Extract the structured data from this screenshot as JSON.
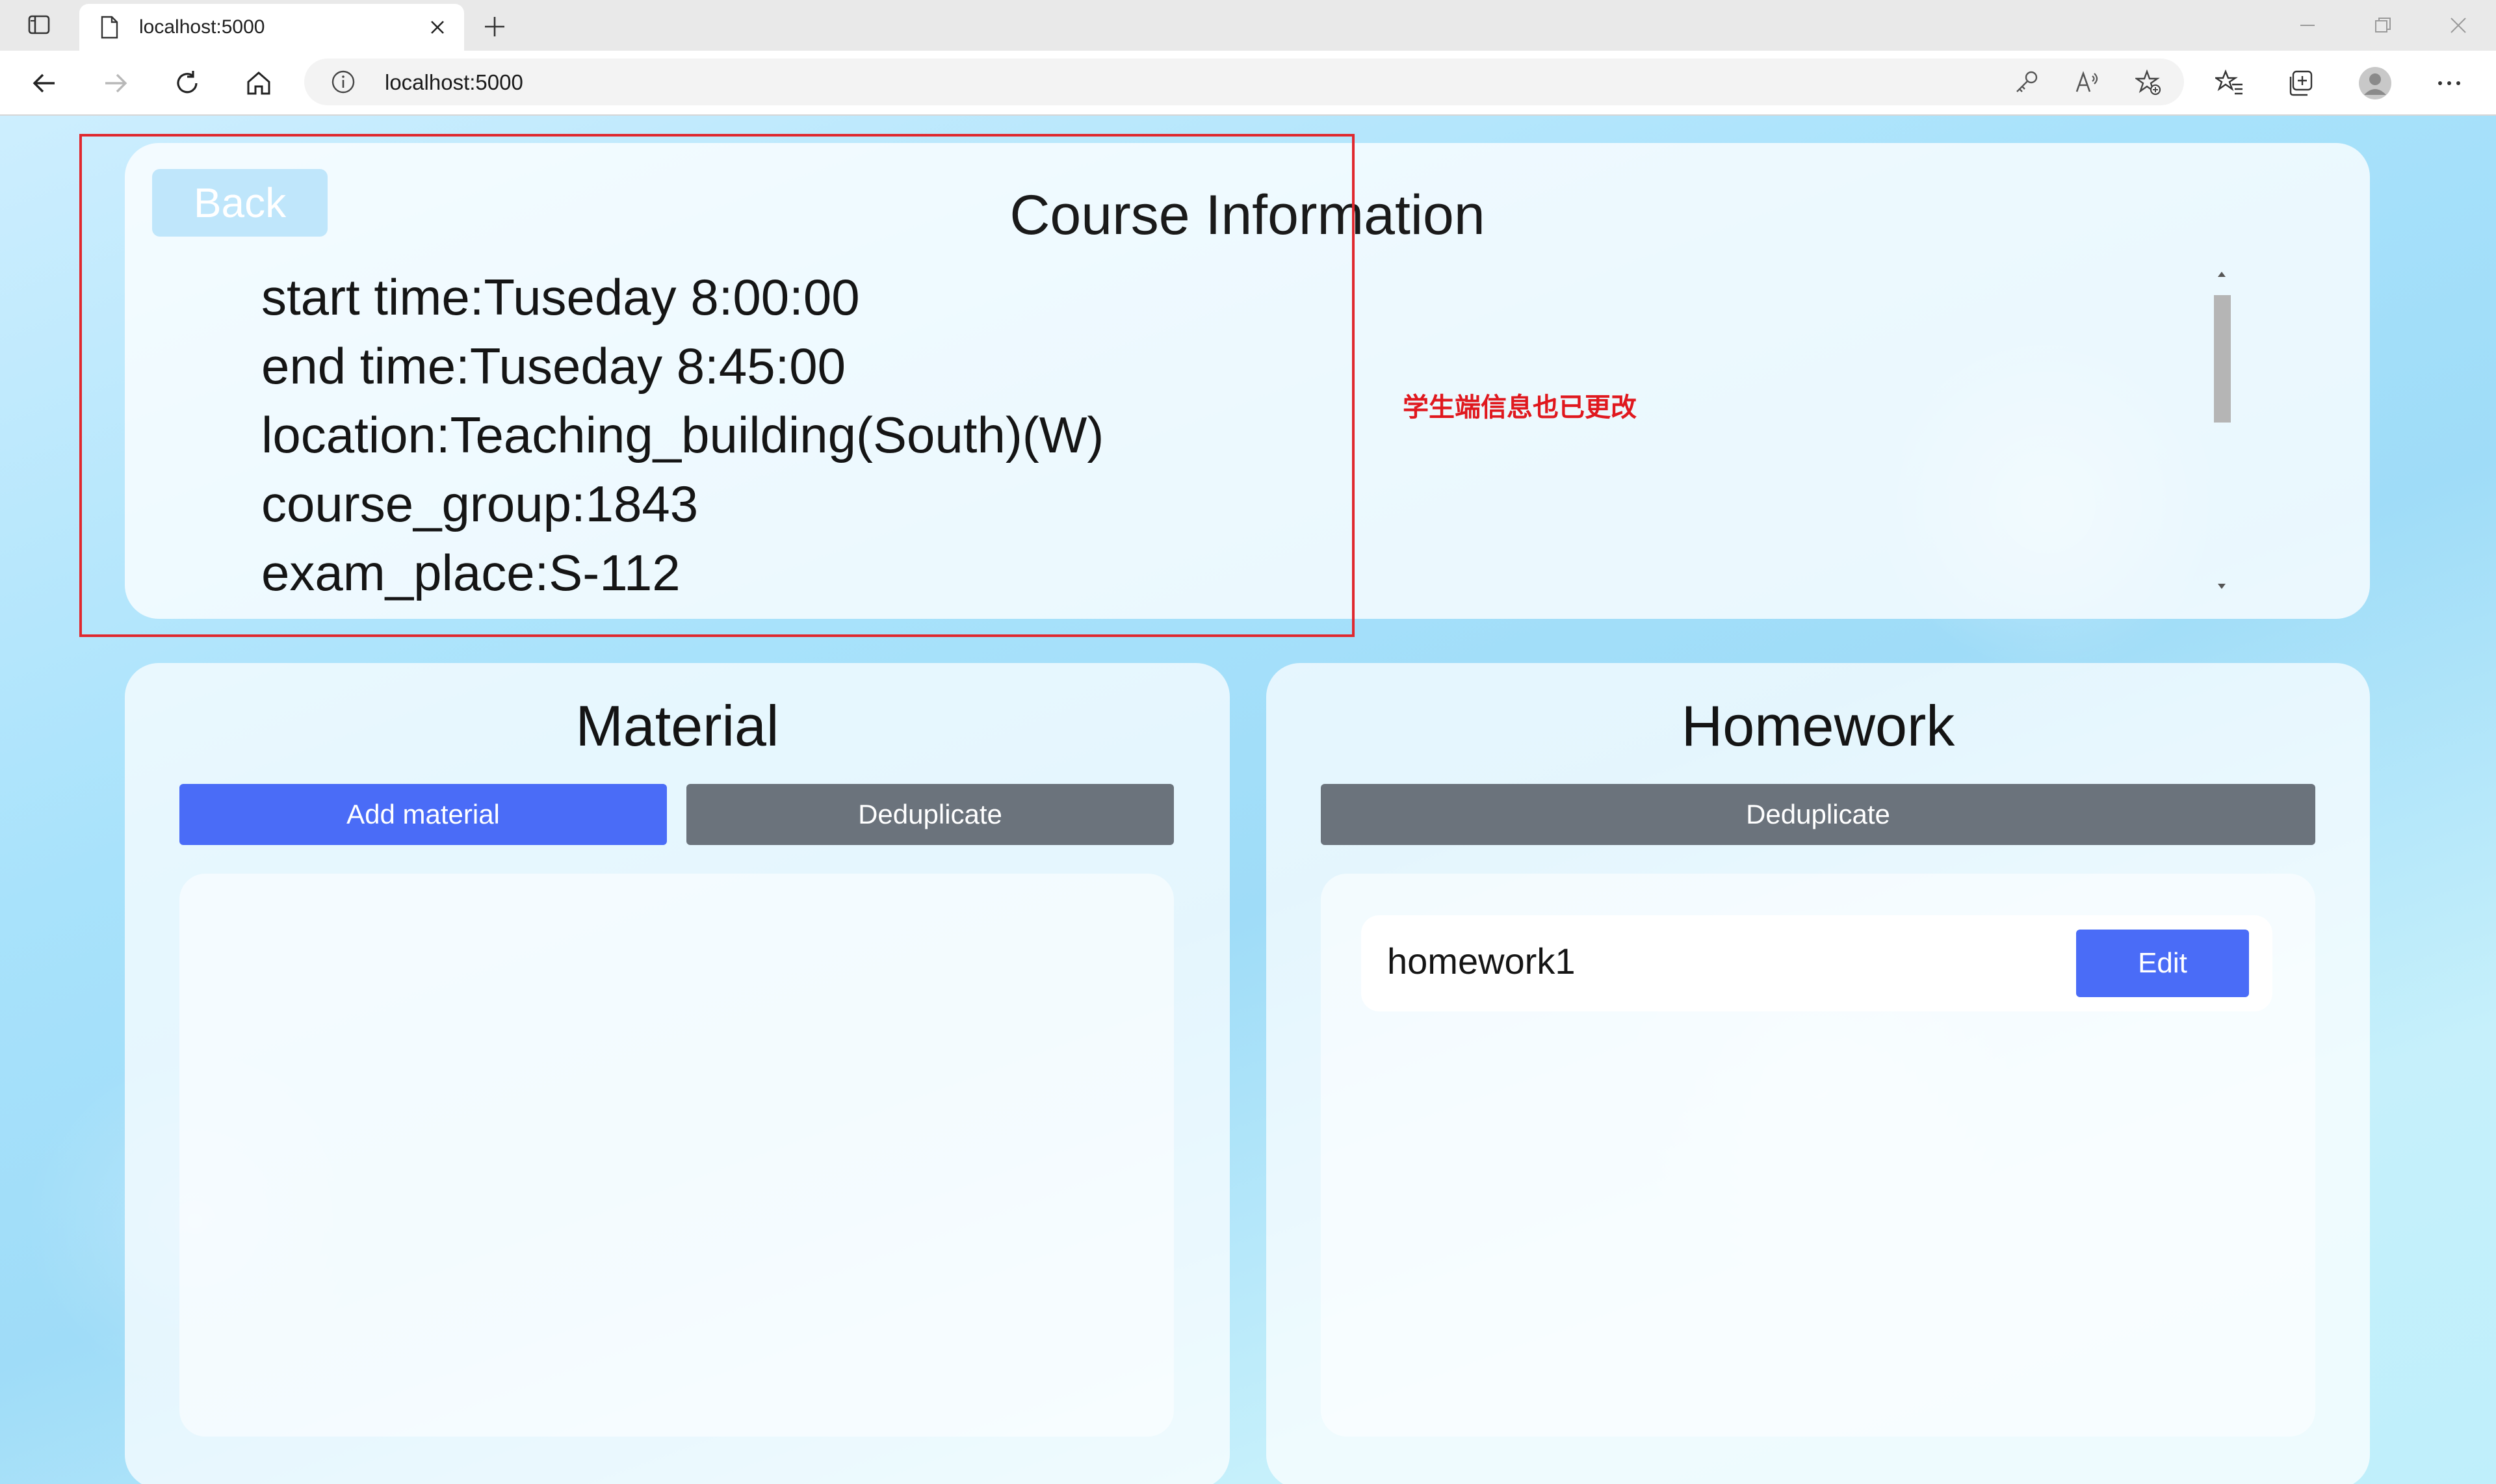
{
  "browser": {
    "tab_title": "localhost:5000",
    "url": "localhost:5000"
  },
  "course": {
    "back_label": "Back",
    "title": "Course Information",
    "info_lines": [
      "start time:Tuseday 8:00:00",
      "end time:Tuseday 8:45:00",
      "location:Teaching_building(South)(W)",
      "course_group:1843",
      "exam_place:S-112"
    ]
  },
  "annotation": {
    "text": "学生端信息也已更改",
    "color": "#e0181e"
  },
  "material": {
    "title": "Material",
    "add_label": "Add material",
    "dedup_label": "Deduplicate"
  },
  "homework": {
    "title": "Homework",
    "dedup_label": "Deduplicate",
    "items": [
      {
        "name": "homework1",
        "edit_label": "Edit"
      }
    ]
  },
  "colors": {
    "primary": "#4a6cf7",
    "secondary": "#6b737c"
  }
}
